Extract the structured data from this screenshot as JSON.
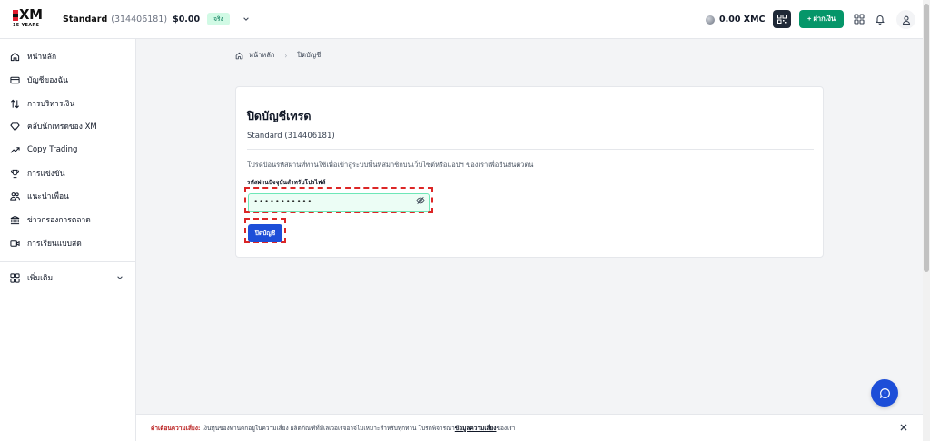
{
  "header": {
    "logo": {
      "mark": "XM",
      "sub": "15 YEARS"
    },
    "account": {
      "name": "Standard",
      "id": "(314406181)",
      "balance": "$0.00",
      "badge": "จริง"
    },
    "xmc": "0.00 XMC",
    "deposit_label": "+ ฝากเงิน",
    "icons": [
      "chevron-down-icon",
      "coin-icon",
      "qr-icon",
      "grid-icon",
      "bell-icon",
      "user-icon"
    ]
  },
  "sidebar": {
    "items": [
      {
        "label": "หน้าหลัก",
        "icon": "home-icon"
      },
      {
        "label": "บัญชีของฉัน",
        "icon": "card-icon"
      },
      {
        "label": "การบริหารเงิน",
        "icon": "transfer-icon"
      },
      {
        "label": "คลับนักเทรดของ XM",
        "icon": "diamond-icon"
      },
      {
        "label": "Copy Trading",
        "icon": "trend-icon"
      },
      {
        "label": "การแข่งขัน",
        "icon": "trophy-icon"
      },
      {
        "label": "แนะนำเพื่อน",
        "icon": "people-icon"
      },
      {
        "label": "ข่าวกรองการตลาด",
        "icon": "bank-icon"
      },
      {
        "label": "การเรียนแบบสด",
        "icon": "video-icon"
      }
    ],
    "more": {
      "label": "เพิ่มเติม",
      "icon": "grid-icon"
    }
  },
  "breadcrumb": {
    "home": "หน้าหลัก",
    "current": "ปิดบัญชี"
  },
  "card": {
    "title": "ปิดบัญชีเทรด",
    "account": "Standard (314406181)",
    "description": "โปรดป้อนรหัสผ่านที่ท่านใช้เพื่อเข้าสู่ระบบพื้นที่สมาชิกบนเว็บไซต์หรือแอปฯ ของเราเพื่อยืนยันตัวตน",
    "field_label": "รหัสผ่านปัจจุบันสำหรับโปรไฟล์",
    "password_value": "•••••••••••",
    "button_label": "ปิดบัญชี"
  },
  "risk_banner": {
    "label": "คำเตือนความเสี่ยง:",
    "text": " เงินทุนของท่านตกอยู่ในความเสี่ยง ผลิตภัณฑ์ที่มีเลเวอเรจอาจไม่เหมาะสำหรับทุกท่าน โปรดพิจารณา",
    "link": "ข้อมูลความเสี่ยง",
    "suffix": "ของเรา"
  },
  "colors": {
    "primary": "#1d4ed8",
    "success": "#059669",
    "danger": "#dc2626"
  }
}
